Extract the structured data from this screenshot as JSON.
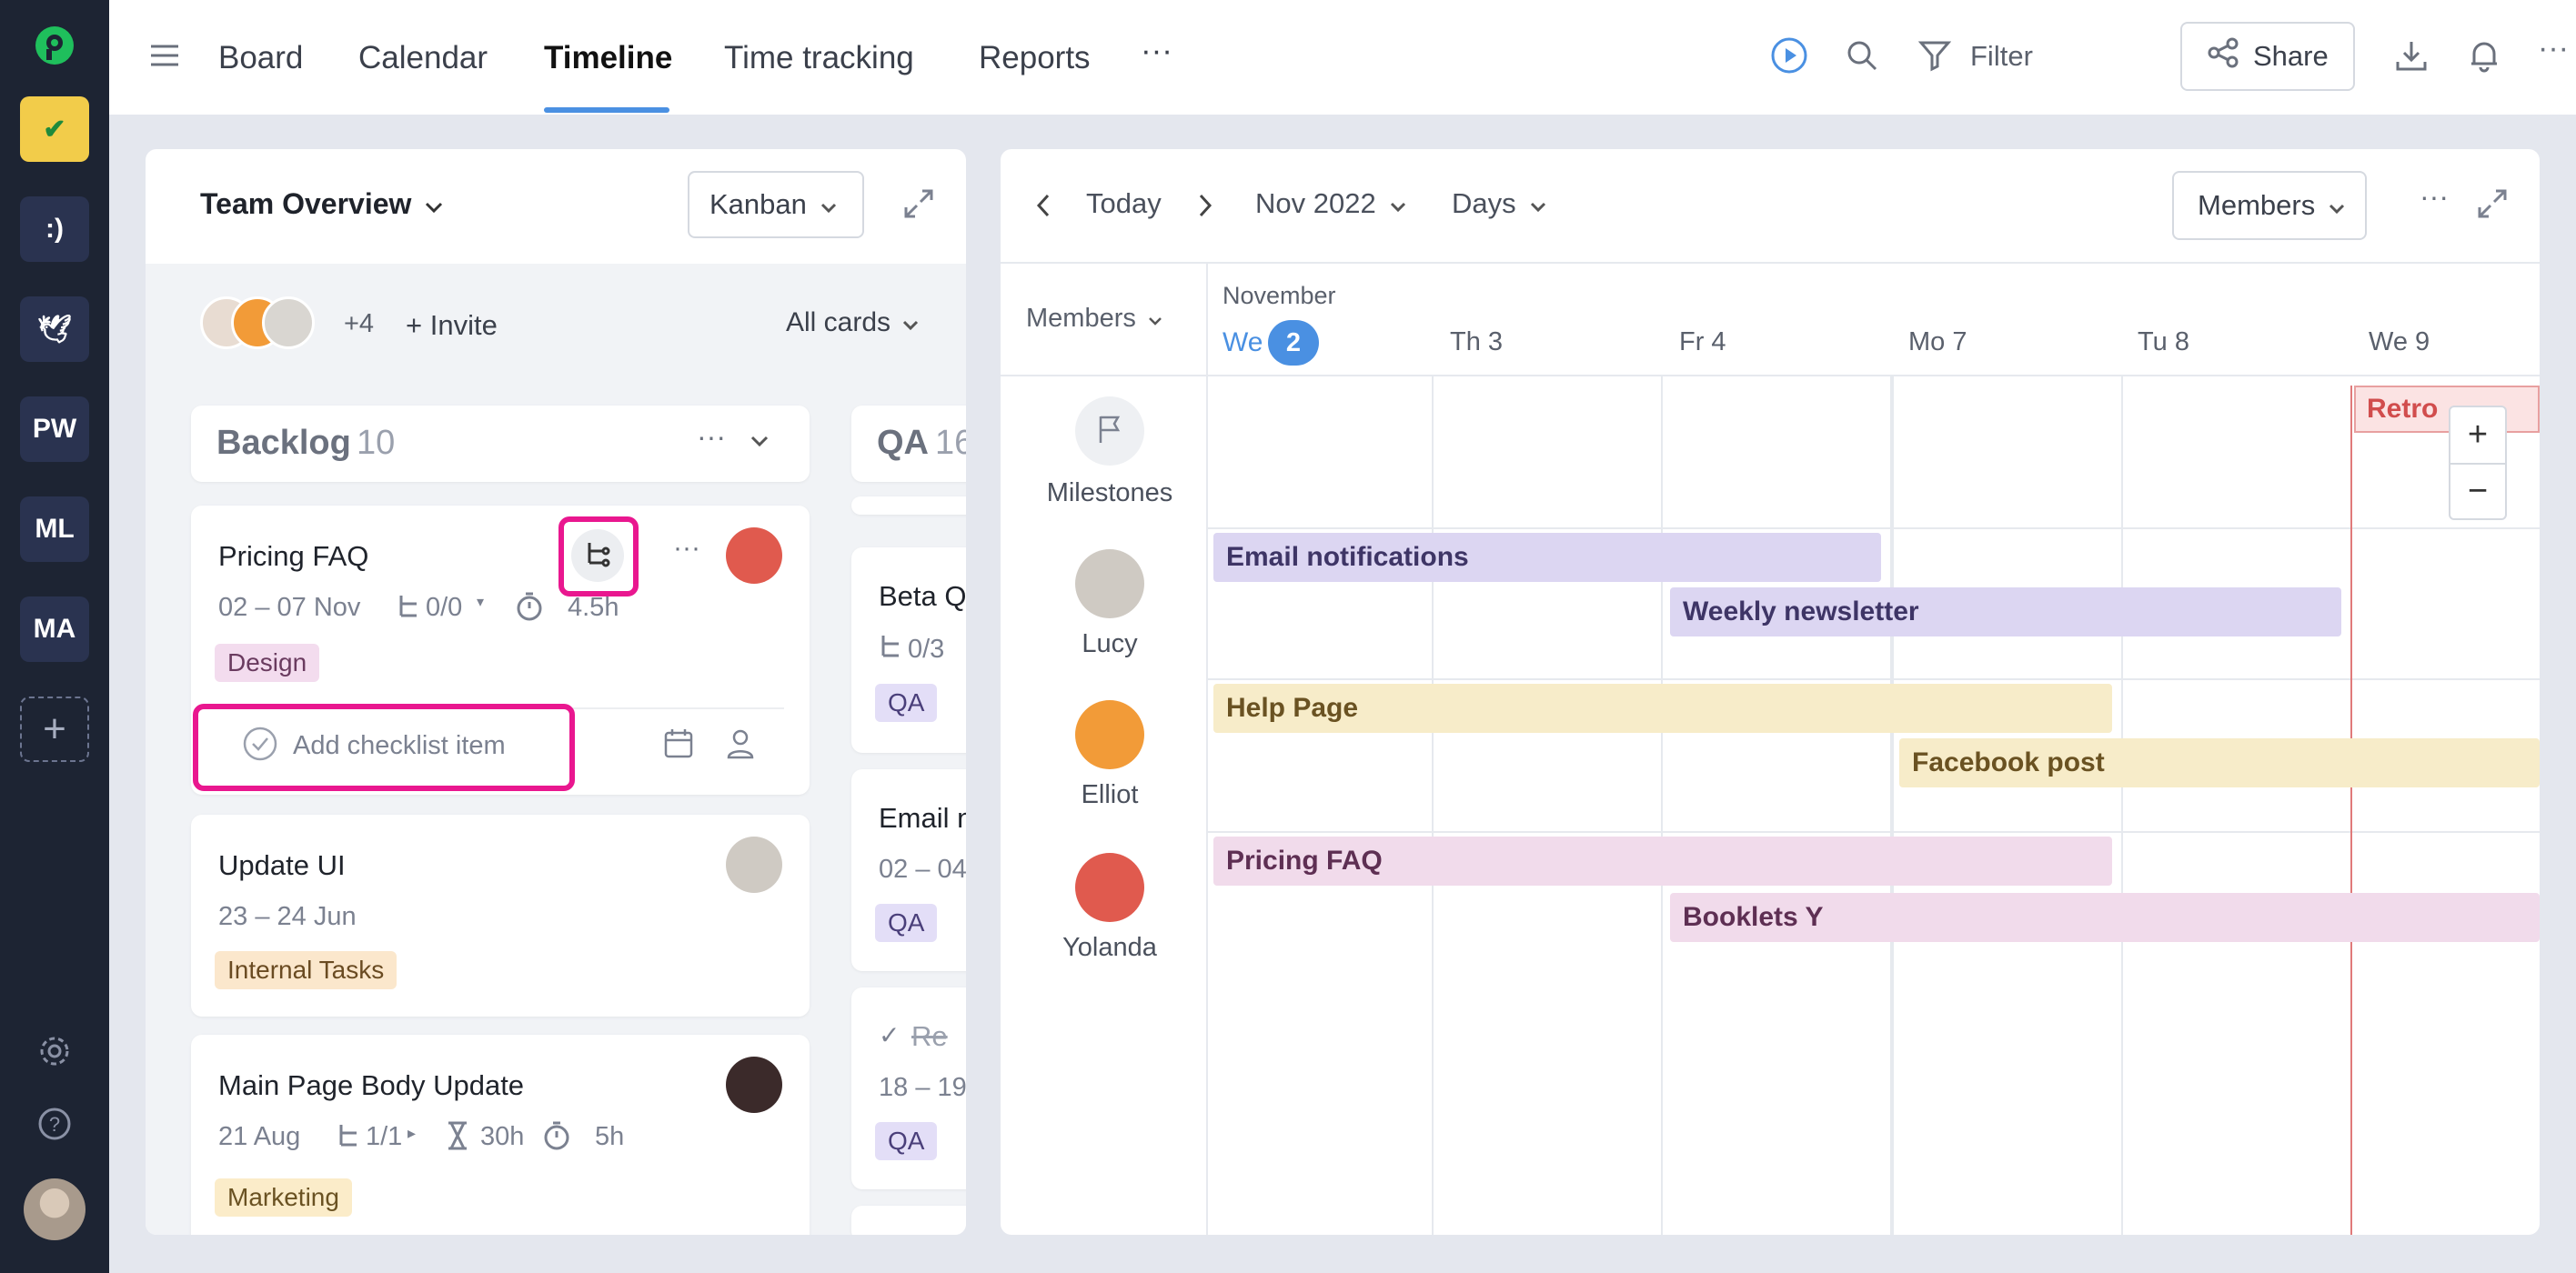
{
  "workspaces": [
    "PW",
    "ML",
    "MA"
  ],
  "workspace_smiley": ":)",
  "nav": {
    "tabs": [
      "Board",
      "Calendar",
      "Timeline",
      "Time tracking",
      "Reports"
    ],
    "more": "···",
    "filter": "Filter",
    "share": "Share",
    "more2": "···"
  },
  "left": {
    "title": "Team Overview",
    "view": "Kanban",
    "members_extra": "+4",
    "invite": "+ Invite",
    "filter": "All cards",
    "backlog": {
      "name": "Backlog",
      "count": "10"
    },
    "qa": {
      "name": "QA",
      "count": "16"
    },
    "cards": [
      {
        "title": "Pricing FAQ",
        "dates": "02 – 07 Nov",
        "subtasks": "0/0",
        "time": "4.5h",
        "tag": "Design",
        "checklist_placeholder": "Add checklist item"
      },
      {
        "title": "Update UI",
        "dates": "23 – 24 Jun",
        "tag": "Internal Tasks"
      },
      {
        "title": "Main Page Body Update",
        "dates": "21 Aug",
        "subtasks": "1/1",
        "estimate": "30h",
        "time": "5h",
        "tag": "Marketing"
      }
    ],
    "qa_cards": [
      {
        "title": "Beta Q",
        "subtasks": "0/3",
        "tag": "QA"
      },
      {
        "title": "Email n",
        "dates": "02 – 04",
        "tag": "QA"
      },
      {
        "title": "Re",
        "dates": "18 – 19",
        "tag": "QA"
      }
    ]
  },
  "timeline": {
    "today": "Today",
    "month": "Nov 2022",
    "scale": "Days",
    "group": "Members",
    "members_col": "Members",
    "month_label": "November",
    "days": [
      {
        "dow": "We",
        "num": "2"
      },
      {
        "label": "Th 3"
      },
      {
        "label": "Fr 4"
      },
      {
        "label": "Mo 7"
      },
      {
        "label": "Tu 8"
      },
      {
        "label": "We 9"
      }
    ],
    "rows": [
      "Milestones",
      "Lucy",
      "Elliot",
      "Yolanda"
    ],
    "milestone": "Retro",
    "bars": [
      {
        "label": "Email notifications",
        "color": "#dcd6f2"
      },
      {
        "label": "Weekly newsletter",
        "color": "#dcd6f2"
      },
      {
        "label": "Help Page",
        "color": "#f7ecc9"
      },
      {
        "label": "Facebook post",
        "color": "#f7ecc9"
      },
      {
        "label": "Pricing FAQ",
        "color": "#f1dbeb"
      },
      {
        "label": "Booklets Y",
        "color": "#f1dbeb"
      }
    ],
    "zoom_in": "+",
    "zoom_out": "−"
  }
}
